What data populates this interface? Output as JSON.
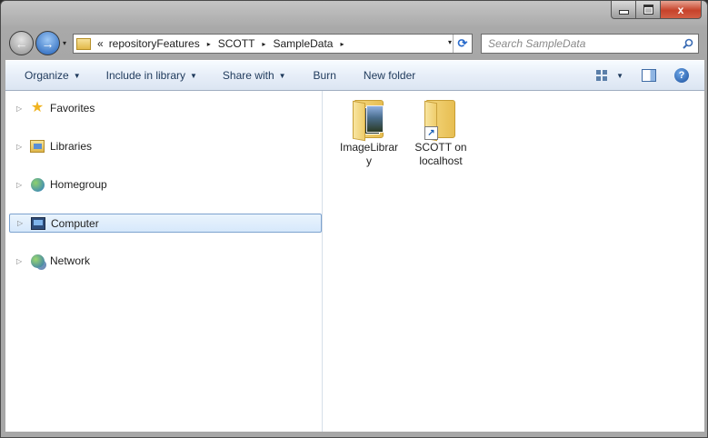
{
  "window": {
    "caption_buttons": [
      "minimize-icon",
      "maximize-icon",
      "close-icon"
    ],
    "close_glyph": "x"
  },
  "nav": {
    "back_glyph": "←",
    "forward_glyph": "→",
    "history_glyph": "▾"
  },
  "address": {
    "overflow_glyph": "«",
    "crumbs": [
      "repositoryFeatures",
      "SCOTT",
      "SampleData"
    ],
    "separator_glyph": "▸",
    "refresh_glyph": "⟳"
  },
  "search": {
    "placeholder": "Search SampleData"
  },
  "toolbar": {
    "organize": "Organize",
    "include_in_library": "Include in library",
    "share_with": "Share with",
    "burn": "Burn",
    "new_folder": "New folder",
    "help": "?"
  },
  "navpane": {
    "items": [
      {
        "label": "Favorites",
        "icon": "star-icon",
        "selected": false
      },
      {
        "label": "Libraries",
        "icon": "libraries-icon",
        "selected": false
      },
      {
        "label": "Homegroup",
        "icon": "homegroup-icon",
        "selected": false
      },
      {
        "label": "Computer",
        "icon": "computer-icon",
        "selected": true
      },
      {
        "label": "Network",
        "icon": "network-icon",
        "selected": false
      }
    ],
    "expander_glyph": "▷"
  },
  "content": {
    "files": [
      {
        "label": "ImageLibrary",
        "icon": "image-folder-icon"
      },
      {
        "label": "SCOTT on localhost",
        "icon": "shortcut-folder-icon"
      }
    ]
  },
  "colors": {
    "accent": "#1e395b",
    "selection_border": "#7da2ce",
    "close_red": "#c7432b"
  }
}
